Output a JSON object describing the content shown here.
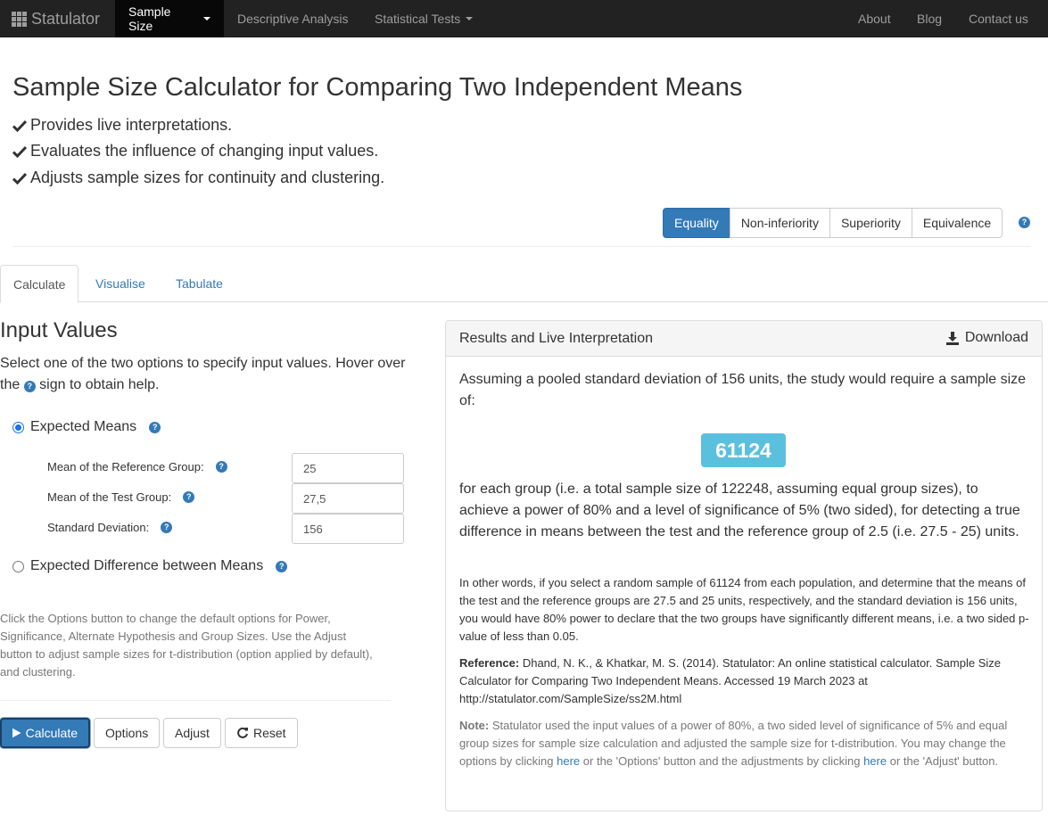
{
  "nav": {
    "brand": "Statulator",
    "items": [
      {
        "label": "Sample Size",
        "dropdown": true,
        "active": true
      },
      {
        "label": "Descriptive Analysis",
        "dropdown": false
      },
      {
        "label": "Statistical Tests",
        "dropdown": true
      }
    ],
    "right": [
      "About",
      "Blog",
      "Contact us"
    ]
  },
  "page": {
    "title": "Sample Size Calculator for Comparing Two Independent Means",
    "features": [
      "Provides live interpretations.",
      "Evaluates the influence of changing input values.",
      "Adjusts sample sizes for continuity and clustering."
    ]
  },
  "hypothesis": {
    "options": [
      "Equality",
      "Non-inferiority",
      "Superiority",
      "Equivalence"
    ],
    "selected": "Equality"
  },
  "tabs": [
    "Calculate",
    "Visualise",
    "Tabulate"
  ],
  "input": {
    "heading": "Input Values",
    "intro_a": "Select one of the two options to specify input values. Hover over the",
    "intro_b": "sign to obtain help.",
    "option1": "Expected Means",
    "option2": "Expected Difference between Means",
    "fields": [
      {
        "label": "Mean of the Reference Group:",
        "value": "25"
      },
      {
        "label": "Mean of the Test Group:",
        "value": "27,5"
      },
      {
        "label": "Standard Deviation:",
        "value": "156"
      }
    ],
    "note": "Click the Options button to change the default options for Power, Significance, Alternate Hypothesis and Group Sizes. Use the Adjust button to adjust sample sizes for t-distribution (option applied by default), and clustering."
  },
  "buttons": {
    "calculate": "Calculate",
    "options": "Options",
    "adjust": "Adjust",
    "reset": "Reset"
  },
  "results": {
    "title": "Results and Live Interpretation",
    "download": "Download",
    "lead": "Assuming a pooled standard deviation of 156 units, the study would require a sample size of:",
    "sample_size": "61124",
    "after": "for each group (i.e. a total sample size of 122248, assuming equal group sizes), to achieve a power of 80% and a level of significance of 5% (two sided), for detecting a true difference in means between the test and the reference group of 2.5 (i.e. 27.5 - 25) units.",
    "other_words": "In other words, if you select a random sample of 61124 from each population, and determine that the means of the test and the reference groups are 27.5 and 25 units, respectively, and the standard deviation is 156 units, you would have 80% power to declare that the two groups have significantly different means, i.e. a two sided p-value of less than 0.05.",
    "reference_label": "Reference:",
    "reference_text": "Dhand, N. K., & Khatkar, M. S. (2014). Statulator: An online statistical calculator. Sample Size Calculator for Comparing Two Independent Means. Accessed 19 March 2023 at http://statulator.com/SampleSize/ss2M.html",
    "note_label": "Note:",
    "note_a": "Statulator used the input values of a power of 80%, a two sided level of significance of 5% and equal group sizes for sample size calculation and adjusted the sample size for t-distribution. You may change the options by clicking",
    "note_link1": "here",
    "note_b": "or the 'Options' button and the adjustments by clicking",
    "note_link2": "here",
    "note_c": "or the 'Adjust' button."
  },
  "colors": {
    "navbar": "#222222",
    "primary": "#337ab7",
    "badge": "#5bc0de"
  }
}
